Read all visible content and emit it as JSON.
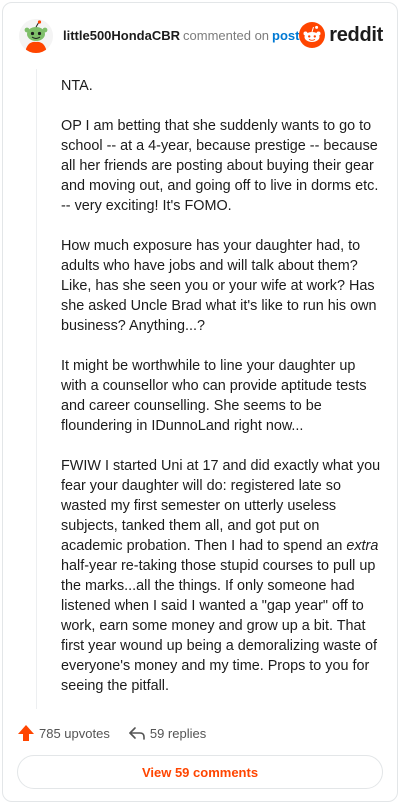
{
  "header": {
    "username": "little500HondaCBR",
    "action_text": "commented on",
    "post_link": "post",
    "brand_word": "reddit"
  },
  "comment": {
    "paragraphs": [
      "NTA.",
      "OP I am betting that she suddenly wants to go to school -- at a 4-year, because prestige -- because all her friends are posting about buying their gear and moving out, and going off to live in dorms etc. -- very exciting! It's FOMO.",
      "How much exposure has your daughter had, to adults who have jobs and will talk about them? Like, has she seen you or your wife at work? Has she asked Uncle Brad what it's like to run his own business? Anything...?",
      "It might be worthwhile to line your daughter up with a counsellor who can provide aptitude tests and career counselling. She seems to be floundering in IDunnoLand right now..."
    ],
    "last_paragraph": {
      "before_em": "FWIW I started Uni at 17 and did exactly what you fear your daughter will do: registered late so wasted my first semester on utterly useless subjects, tanked them all, and got put on academic probation. Then I had to spend an ",
      "em": "extra",
      "after_em": " half-year re-taking those stupid courses to pull up the marks...all the things. If only someone had listened when I said I wanted a \"gap year\" off to work, earn some money and grow up a bit. That first year wound up being a demoralizing waste of everyone's money and my time. Props to you for seeing the pitfall."
    }
  },
  "footer": {
    "upvotes": "785 upvotes",
    "replies": "59 replies",
    "view_comments": "View 59 comments"
  },
  "colors": {
    "accent": "#ff4500",
    "link": "#0079d3",
    "border": "#e3e6e8"
  },
  "icons": {
    "avatar": "snoo-avatar",
    "brand": "reddit-logo-icon",
    "upvote": "upvote-arrow-icon",
    "reply": "reply-arrow-icon"
  }
}
